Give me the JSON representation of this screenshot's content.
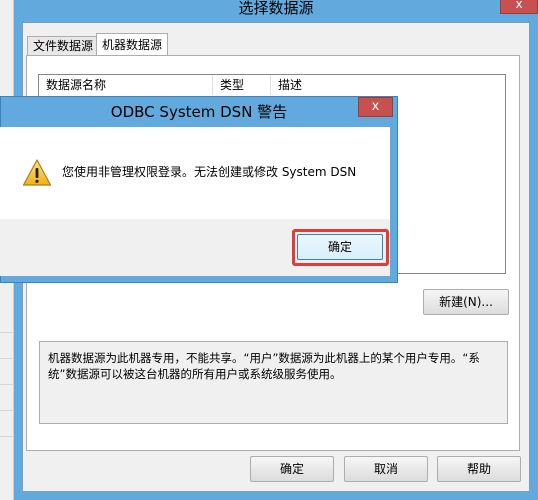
{
  "main_dialog": {
    "title": "选择数据源",
    "close_glyph": "x",
    "tabs": [
      {
        "label": "文件数据源",
        "active": false
      },
      {
        "label": "机器数据源",
        "active": true
      }
    ],
    "list_columns": [
      "数据源名称",
      "类型",
      "描述"
    ],
    "new_button": "新建(N)...",
    "info_text": "机器数据源为此机器专用，不能共享。“用户”数据源为此机器上的某个用户专用。“系统”数据源可以被这台机器的所有用户或系统级服务使用。",
    "buttons": {
      "ok": "确定",
      "cancel": "取消",
      "help": "帮助"
    }
  },
  "warning_dialog": {
    "title": "ODBC System DSN 警告",
    "close_glyph": "x",
    "icon": "warning-icon",
    "message": "您使用非管理权限登录。无法创建或修改 System DSN",
    "ok_button": "确定",
    "highlight_color": "#e53a3a"
  },
  "colors": {
    "frame": "#62a9dd",
    "close": "#c75050",
    "client": "#f0f0f0"
  }
}
